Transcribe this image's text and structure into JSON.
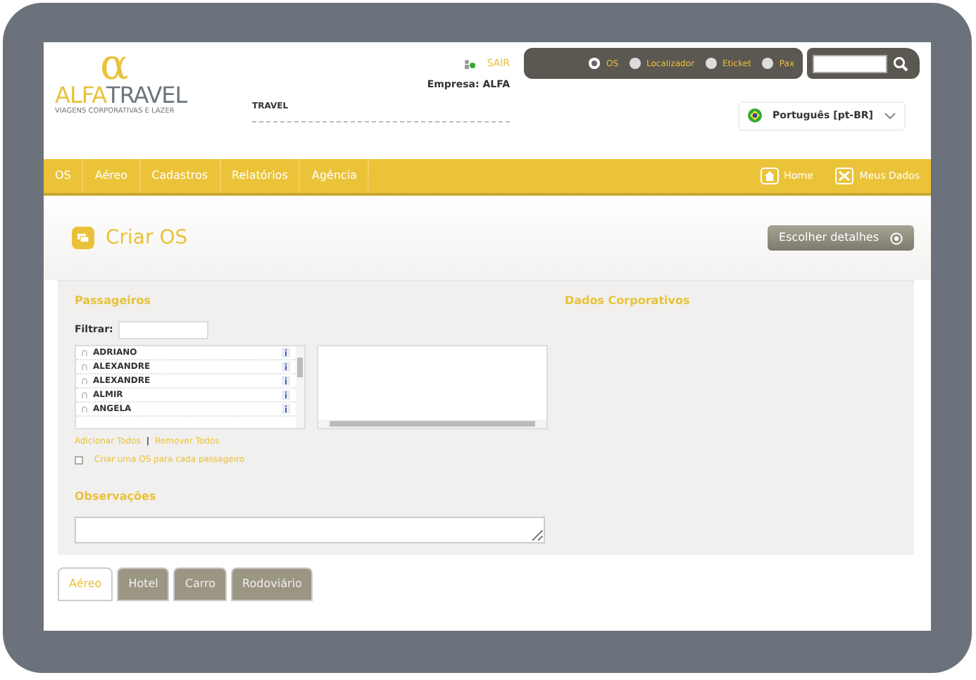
{
  "header": {
    "logo": {
      "symbol": "α",
      "brand_first": "ALFA",
      "brand_second": "TRAVEL",
      "tagline": "VIAGENS CORPORATIVAS E LAZER"
    },
    "logout": "SAIR",
    "company": {
      "label": "Empresa:",
      "value": "ALFA"
    },
    "user": "TRAVEL",
    "search_types": [
      {
        "label": "OS",
        "selected": true
      },
      {
        "label": "Localizador",
        "selected": false
      },
      {
        "label": "Eticket",
        "selected": false
      },
      {
        "label": "Pax",
        "selected": false
      }
    ],
    "language": "Português [pt-BR]"
  },
  "nav": {
    "items": [
      "OS",
      "Aéreo",
      "Cadastros",
      "Relatórios",
      "Agência"
    ],
    "right_items": [
      "Home",
      "Meus Dados"
    ]
  },
  "page_title": "Criar OS",
  "details_button": "Escolher detalhes",
  "passengers": {
    "title": "Passageiros",
    "filter_label": "Filtrar:",
    "names": [
      "ADRIANO",
      "ALEXANDRE",
      "ALEXANDRE",
      "ALMIR",
      "ANGELA"
    ],
    "add_all": "Adicionar Todos",
    "separator": "|",
    "remove_all": "Remover Todos",
    "one_per_passenger": {
      "label": "Criar uma OS para cada passageiro",
      "checked": false
    }
  },
  "corporate_title": "Dados Corporativos",
  "notes_title": "Observações",
  "tabs": [
    {
      "label": "Aéreo",
      "selected": true
    },
    {
      "label": "Hotel",
      "selected": false
    },
    {
      "label": "Carro",
      "selected": false
    },
    {
      "label": "Rodoviário",
      "selected": false
    }
  ]
}
